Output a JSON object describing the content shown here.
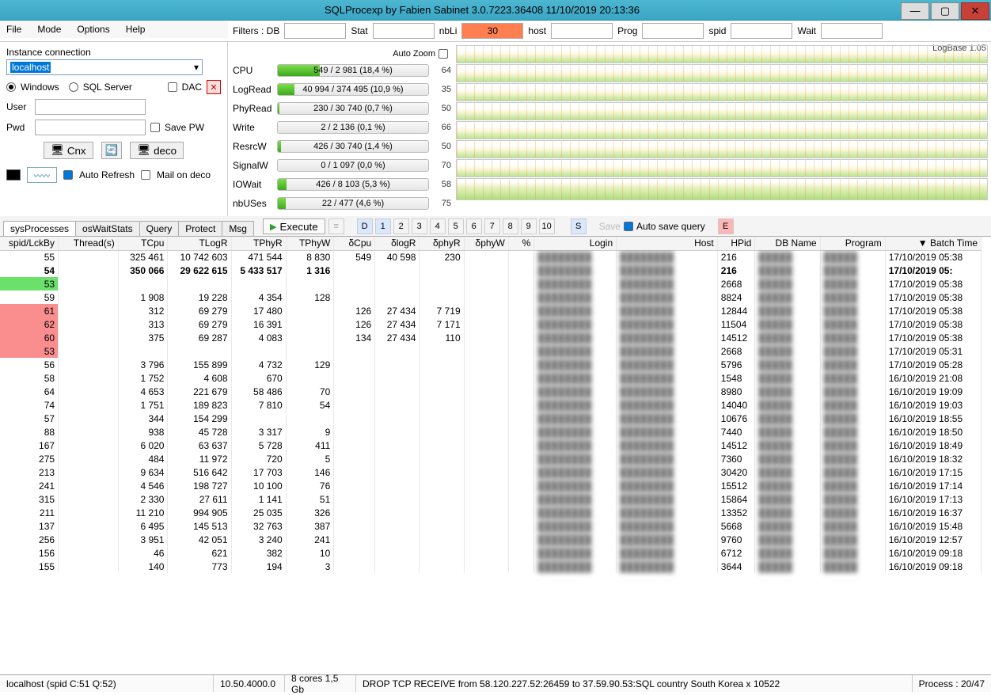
{
  "title": "SQLProcexp by Fabien Sabinet 3.0.7223.36408 11/10/2019 20:13:36",
  "menu": [
    "File",
    "Mode",
    "Options",
    "Help"
  ],
  "connection": {
    "title": "Instance connection",
    "host": "localhost",
    "radio_windows": "Windows",
    "radio_sql": "SQL Server",
    "dac": "DAC",
    "user": "User",
    "pwd": "Pwd",
    "save_pw": "Save PW",
    "cnx": "Cnx",
    "deco": "deco",
    "auto_refresh": "Auto Refresh",
    "mail_on_deco": "Mail on deco"
  },
  "filters": {
    "label": "Filters : DB",
    "stat": "Stat",
    "nbLi": "nbLi",
    "nbLi_val": "30",
    "host": "host",
    "prog": "Prog",
    "spid": "spid",
    "wait": "Wait"
  },
  "autozoom": "Auto Zoom",
  "logbase": "LogBase 1.05",
  "metrics": [
    {
      "name": "CPU",
      "text": "549 / 2 981 (18,4 %)",
      "fill": 28,
      "peak": "64"
    },
    {
      "name": "LogRead",
      "text": "40 994 / 374 495 (10,9 %)",
      "fill": 11,
      "peak": "35"
    },
    {
      "name": "PhyRead",
      "text": "230 / 30 740 (0,7 %)",
      "fill": 1,
      "peak": "50"
    },
    {
      "name": "Write",
      "text": "2 / 2 136 (0,1 %)",
      "fill": 0,
      "peak": "66"
    },
    {
      "name": "ResrcW",
      "text": "426 / 30 740 (1,4 %)",
      "fill": 2,
      "peak": "50"
    },
    {
      "name": "SignalW",
      "text": "0 / 1 097 (0,0 %)",
      "fill": 0,
      "peak": "70"
    },
    {
      "name": "IOWait",
      "text": "426 / 8 103 (5,3 %)",
      "fill": 6,
      "peak": "58"
    },
    {
      "name": "nbUSes",
      "text": "22 / 477 (4,6 %)",
      "fill": 5,
      "peak": "75"
    }
  ],
  "tabs": [
    "sysProcesses",
    "osWaitStats",
    "Query",
    "Protect",
    "Msg"
  ],
  "toolbar": {
    "execute": "Execute",
    "nums": [
      "D",
      "1",
      "2",
      "3",
      "4",
      "5",
      "6",
      "7",
      "8",
      "9",
      "10"
    ],
    "s": "S",
    "save": "Save",
    "autosave": "Auto save query",
    "e": "E"
  },
  "columns": [
    "spid/LckBy",
    "Thread(s)",
    "TCpu",
    "TLogR",
    "TPhyR",
    "TPhyW",
    "δCpu",
    "δlogR",
    "δphyR",
    "δphyW",
    "%",
    "Login",
    "Host",
    "HPid",
    "DB Name",
    "Program",
    "▼ Batch Time"
  ],
  "rows": [
    {
      "spid": "55",
      "tcpu": "325 461",
      "tlogr": "10 742 603",
      "tphyr": "471 544",
      "tphyw": "8 830",
      "dcpu": "549",
      "dlogr": "40 598",
      "dphyr": "230",
      "dphyw": "",
      "hpid": "216",
      "bt": "17/10/2019 05:38"
    },
    {
      "spid": "54",
      "bold": true,
      "tcpu": "350 066",
      "tlogr": "29 622 615",
      "tphyr": "5 433 517",
      "tphyw": "1 316",
      "dcpu": "",
      "dlogr": "",
      "dphyr": "",
      "dphyw": "",
      "hpid": "216",
      "bt": "17/10/2019 05:"
    },
    {
      "spid": "53",
      "green": true,
      "tcpu": "",
      "tlogr": "",
      "tphyr": "",
      "tphyw": "",
      "dcpu": "",
      "dlogr": "",
      "dphyr": "",
      "dphyw": "",
      "hpid": "2668",
      "bt": "17/10/2019 05:38"
    },
    {
      "spid": "59",
      "tcpu": "1 908",
      "tlogr": "19 228",
      "tphyr": "4 354",
      "tphyw": "128",
      "dcpu": "",
      "dlogr": "",
      "dphyr": "",
      "dphyw": "",
      "hpid": "8824",
      "bt": "17/10/2019 05:38"
    },
    {
      "spid": "61",
      "red": true,
      "tcpu": "312",
      "tlogr": "69 279",
      "tphyr": "17 480",
      "tphyw": "",
      "dcpu": "126",
      "dlogr": "27 434",
      "dphyr": "7 719",
      "dphyw": "",
      "hpid": "12844",
      "bt": "17/10/2019 05:38"
    },
    {
      "spid": "62",
      "red": true,
      "tcpu": "313",
      "tlogr": "69 279",
      "tphyr": "16 391",
      "tphyw": "",
      "dcpu": "126",
      "dlogr": "27 434",
      "dphyr": "7 171",
      "dphyw": "",
      "hpid": "11504",
      "bt": "17/10/2019 05:38"
    },
    {
      "spid": "60",
      "red": true,
      "tcpu": "375",
      "tlogr": "69 287",
      "tphyr": "4 083",
      "tphyw": "",
      "dcpu": "134",
      "dlogr": "27 434",
      "dphyr": "110",
      "dphyw": "",
      "hpid": "14512",
      "bt": "17/10/2019 05:38"
    },
    {
      "spid": "53",
      "red": true,
      "tcpu": "",
      "tlogr": "",
      "tphyr": "",
      "tphyw": "",
      "dcpu": "",
      "dlogr": "",
      "dphyr": "",
      "dphyw": "",
      "hpid": "2668",
      "bt": "17/10/2019 05:31"
    },
    {
      "spid": "56",
      "tcpu": "3 796",
      "tlogr": "155 899",
      "tphyr": "4 732",
      "tphyw": "129",
      "dcpu": "",
      "dlogr": "",
      "dphyr": "",
      "dphyw": "",
      "hpid": "5796",
      "bt": "17/10/2019 05:28"
    },
    {
      "spid": "58",
      "tcpu": "1 752",
      "tlogr": "4 608",
      "tphyr": "670",
      "tphyw": "",
      "dcpu": "",
      "dlogr": "",
      "dphyr": "",
      "dphyw": "",
      "hpid": "1548",
      "bt": "16/10/2019 21:08"
    },
    {
      "spid": "64",
      "tcpu": "4 653",
      "tlogr": "221 679",
      "tphyr": "58 486",
      "tphyw": "70",
      "dcpu": "",
      "dlogr": "",
      "dphyr": "",
      "dphyw": "",
      "hpid": "8980",
      "bt": "16/10/2019 19:09"
    },
    {
      "spid": "74",
      "tcpu": "1 751",
      "tlogr": "189 823",
      "tphyr": "7 810",
      "tphyw": "54",
      "dcpu": "",
      "dlogr": "",
      "dphyr": "",
      "dphyw": "",
      "hpid": "14040",
      "bt": "16/10/2019 19:03"
    },
    {
      "spid": "57",
      "tcpu": "344",
      "tlogr": "154 299",
      "tphyr": "",
      "tphyw": "",
      "dcpu": "",
      "dlogr": "",
      "dphyr": "",
      "dphyw": "",
      "hpid": "10676",
      "bt": "16/10/2019 18:55"
    },
    {
      "spid": "88",
      "tcpu": "938",
      "tlogr": "45 728",
      "tphyr": "3 317",
      "tphyw": "9",
      "dcpu": "",
      "dlogr": "",
      "dphyr": "",
      "dphyw": "",
      "hpid": "7440",
      "bt": "16/10/2019 18:50"
    },
    {
      "spid": "167",
      "tcpu": "6 020",
      "tlogr": "63 637",
      "tphyr": "5 728",
      "tphyw": "411",
      "dcpu": "",
      "dlogr": "",
      "dphyr": "",
      "dphyw": "",
      "hpid": "14512",
      "bt": "16/10/2019 18:49"
    },
    {
      "spid": "275",
      "tcpu": "484",
      "tlogr": "11 972",
      "tphyr": "720",
      "tphyw": "5",
      "dcpu": "",
      "dlogr": "",
      "dphyr": "",
      "dphyw": "",
      "hpid": "7360",
      "bt": "16/10/2019 18:32"
    },
    {
      "spid": "213",
      "tcpu": "9 634",
      "tlogr": "516 642",
      "tphyr": "17 703",
      "tphyw": "146",
      "dcpu": "",
      "dlogr": "",
      "dphyr": "",
      "dphyw": "",
      "hpid": "30420",
      "bt": "16/10/2019 17:15"
    },
    {
      "spid": "241",
      "tcpu": "4 546",
      "tlogr": "198 727",
      "tphyr": "10 100",
      "tphyw": "76",
      "dcpu": "",
      "dlogr": "",
      "dphyr": "",
      "dphyw": "",
      "hpid": "15512",
      "bt": "16/10/2019 17:14"
    },
    {
      "spid": "315",
      "tcpu": "2 330",
      "tlogr": "27 611",
      "tphyr": "1 141",
      "tphyw": "51",
      "dcpu": "",
      "dlogr": "",
      "dphyr": "",
      "dphyw": "",
      "hpid": "15864",
      "bt": "16/10/2019 17:13"
    },
    {
      "spid": "211",
      "tcpu": "11 210",
      "tlogr": "994 905",
      "tphyr": "25 035",
      "tphyw": "326",
      "dcpu": "",
      "dlogr": "",
      "dphyr": "",
      "dphyw": "",
      "hpid": "13352",
      "bt": "16/10/2019 16:37"
    },
    {
      "spid": "137",
      "tcpu": "6 495",
      "tlogr": "145 513",
      "tphyr": "32 763",
      "tphyw": "387",
      "dcpu": "",
      "dlogr": "",
      "dphyr": "",
      "dphyw": "",
      "hpid": "5668",
      "bt": "16/10/2019 15:48"
    },
    {
      "spid": "256",
      "tcpu": "3 951",
      "tlogr": "42 051",
      "tphyr": "3 240",
      "tphyw": "241",
      "dcpu": "",
      "dlogr": "",
      "dphyr": "",
      "dphyw": "",
      "hpid": "9760",
      "bt": "16/10/2019 12:57"
    },
    {
      "spid": "156",
      "tcpu": "46",
      "tlogr": "621",
      "tphyr": "382",
      "tphyw": "10",
      "dcpu": "",
      "dlogr": "",
      "dphyr": "",
      "dphyw": "",
      "hpid": "6712",
      "bt": "16/10/2019 09:18"
    },
    {
      "spid": "155",
      "tcpu": "140",
      "tlogr": "773",
      "tphyr": "194",
      "tphyw": "3",
      "dcpu": "",
      "dlogr": "",
      "dphyr": "",
      "dphyw": "",
      "hpid": "3644",
      "bt": "16/10/2019 09:18"
    }
  ],
  "status": {
    "conn": "localhost (spid C:51 Q:52)",
    "ver": "10.50.4000.0",
    "hw": "8 cores 1,5 Gb",
    "msg": "DROP TCP RECEIVE from 58.120.227.52:26459 to 37.59.90.53:SQL country South Korea x 10522",
    "proc": "Process : 20/47"
  }
}
